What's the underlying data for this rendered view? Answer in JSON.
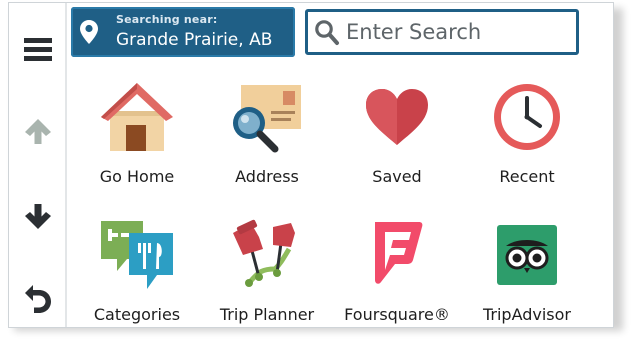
{
  "location": {
    "caption": "Searching near:",
    "place": "Grande Prairie, AB"
  },
  "search": {
    "placeholder": "Enter Search",
    "value": ""
  },
  "sidebar": {
    "items": [
      {
        "icon": "menu-icon"
      },
      {
        "icon": "arrow-up-icon",
        "state": "disabled"
      },
      {
        "icon": "arrow-down-icon"
      },
      {
        "icon": "back-icon"
      }
    ]
  },
  "tiles": [
    {
      "label": "Go Home",
      "icon": "home-icon"
    },
    {
      "label": "Address",
      "icon": "address-icon"
    },
    {
      "label": "Saved",
      "icon": "heart-icon"
    },
    {
      "label": "Recent",
      "icon": "clock-icon"
    },
    {
      "label": "Categories",
      "icon": "categories-icon"
    },
    {
      "label": "Trip Planner",
      "icon": "trip-planner-icon"
    },
    {
      "label": "Foursquare®",
      "icon": "foursquare-icon"
    },
    {
      "label": "TripAdvisor",
      "icon": "tripadvisor-icon"
    }
  ],
  "colors": {
    "accent": "#1f5f86",
    "disabled": "#a9b4ae",
    "icon_dark": "#2b2f33"
  }
}
